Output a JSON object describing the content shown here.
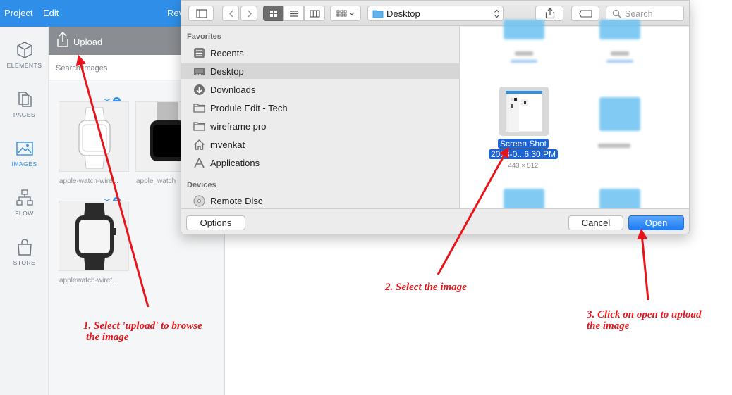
{
  "menu": {
    "project": "Project",
    "edit": "Edit",
    "partial": "Rev"
  },
  "rail": [
    {
      "label": "ELEMENTS",
      "icon": "cube-icon"
    },
    {
      "label": "PAGES",
      "icon": "pages-icon"
    },
    {
      "label": "IMAGES",
      "icon": "image-icon"
    },
    {
      "label": "FLOW",
      "icon": "flow-icon"
    },
    {
      "label": "STORE",
      "icon": "bag-icon"
    }
  ],
  "panel": {
    "upload_label": "Upload",
    "search_text": "Search images",
    "thumbs": [
      {
        "name": "apple-watch-wire..."
      },
      {
        "name": "apple_watch"
      },
      {
        "name": "applewatch-wiref..."
      }
    ]
  },
  "dialog": {
    "location": "Desktop",
    "search_placeholder": "Search",
    "favorites_heading": "Favorites",
    "devices_heading": "Devices",
    "favorites": [
      {
        "label": "Recents",
        "icon": "recents-icon"
      },
      {
        "label": "Desktop",
        "icon": "desktop-icon"
      },
      {
        "label": "Downloads",
        "icon": "downloads-icon"
      },
      {
        "label": "Produle Edit - Tech",
        "icon": "folder-icon"
      },
      {
        "label": "wireframe pro",
        "icon": "folder-icon"
      },
      {
        "label": "mvenkat",
        "icon": "home-icon"
      },
      {
        "label": "Applications",
        "icon": "applications-icon"
      }
    ],
    "devices": [
      {
        "label": "Remote Disc",
        "icon": "disc-icon"
      }
    ],
    "selected_file": {
      "line1": "Screen Shot",
      "line2": "2018-0...6.30 PM",
      "dimensions": "443 × 512"
    },
    "options_label": "Options",
    "cancel_label": "Cancel",
    "open_label": "Open"
  },
  "annotations": {
    "step1_line1": "1. Select 'upload' to browse",
    "step1_line2": "the image",
    "step2": "2. Select the image",
    "step3_line1": "3. Click on open to upload",
    "step3_line2": "the image"
  },
  "colors": {
    "accent": "#2f8fe8",
    "annotation": "#e8141b",
    "selection": "#1d64d6"
  }
}
